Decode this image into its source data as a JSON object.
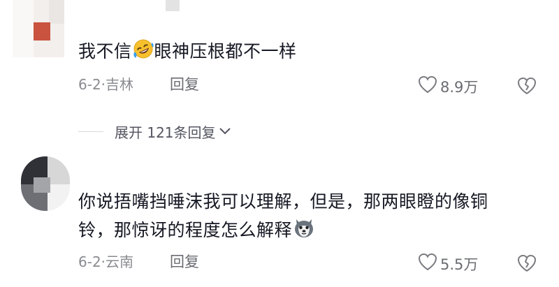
{
  "comments": [
    {
      "text_before": "我不信",
      "emoji": "rolling-on-floor-laughing-emoji",
      "text_after": "眼神压根都不一样",
      "date_location": "6-2·吉林",
      "reply_label": "回复",
      "likes": "8.9万"
    },
    {
      "text_line1": "你说捂嘴挡唾沫我可以理解，但是，那两眼瞪的像铜",
      "text_line2": "铃，那惊讶的程度怎么解释",
      "emoji": "husky-dog-emoji",
      "date_location": "6-2·云南",
      "reply_label": "回复",
      "likes": "5.5万"
    }
  ],
  "expand_replies": {
    "label": "展开 121条回复",
    "icon": "chevron-down-icon"
  },
  "colors": {
    "text": "#161823",
    "meta": "#8a8b91",
    "icon": "#7a7b80",
    "emoji_face": "#f7c12e",
    "emoji_blue": "#3aa0f0"
  }
}
